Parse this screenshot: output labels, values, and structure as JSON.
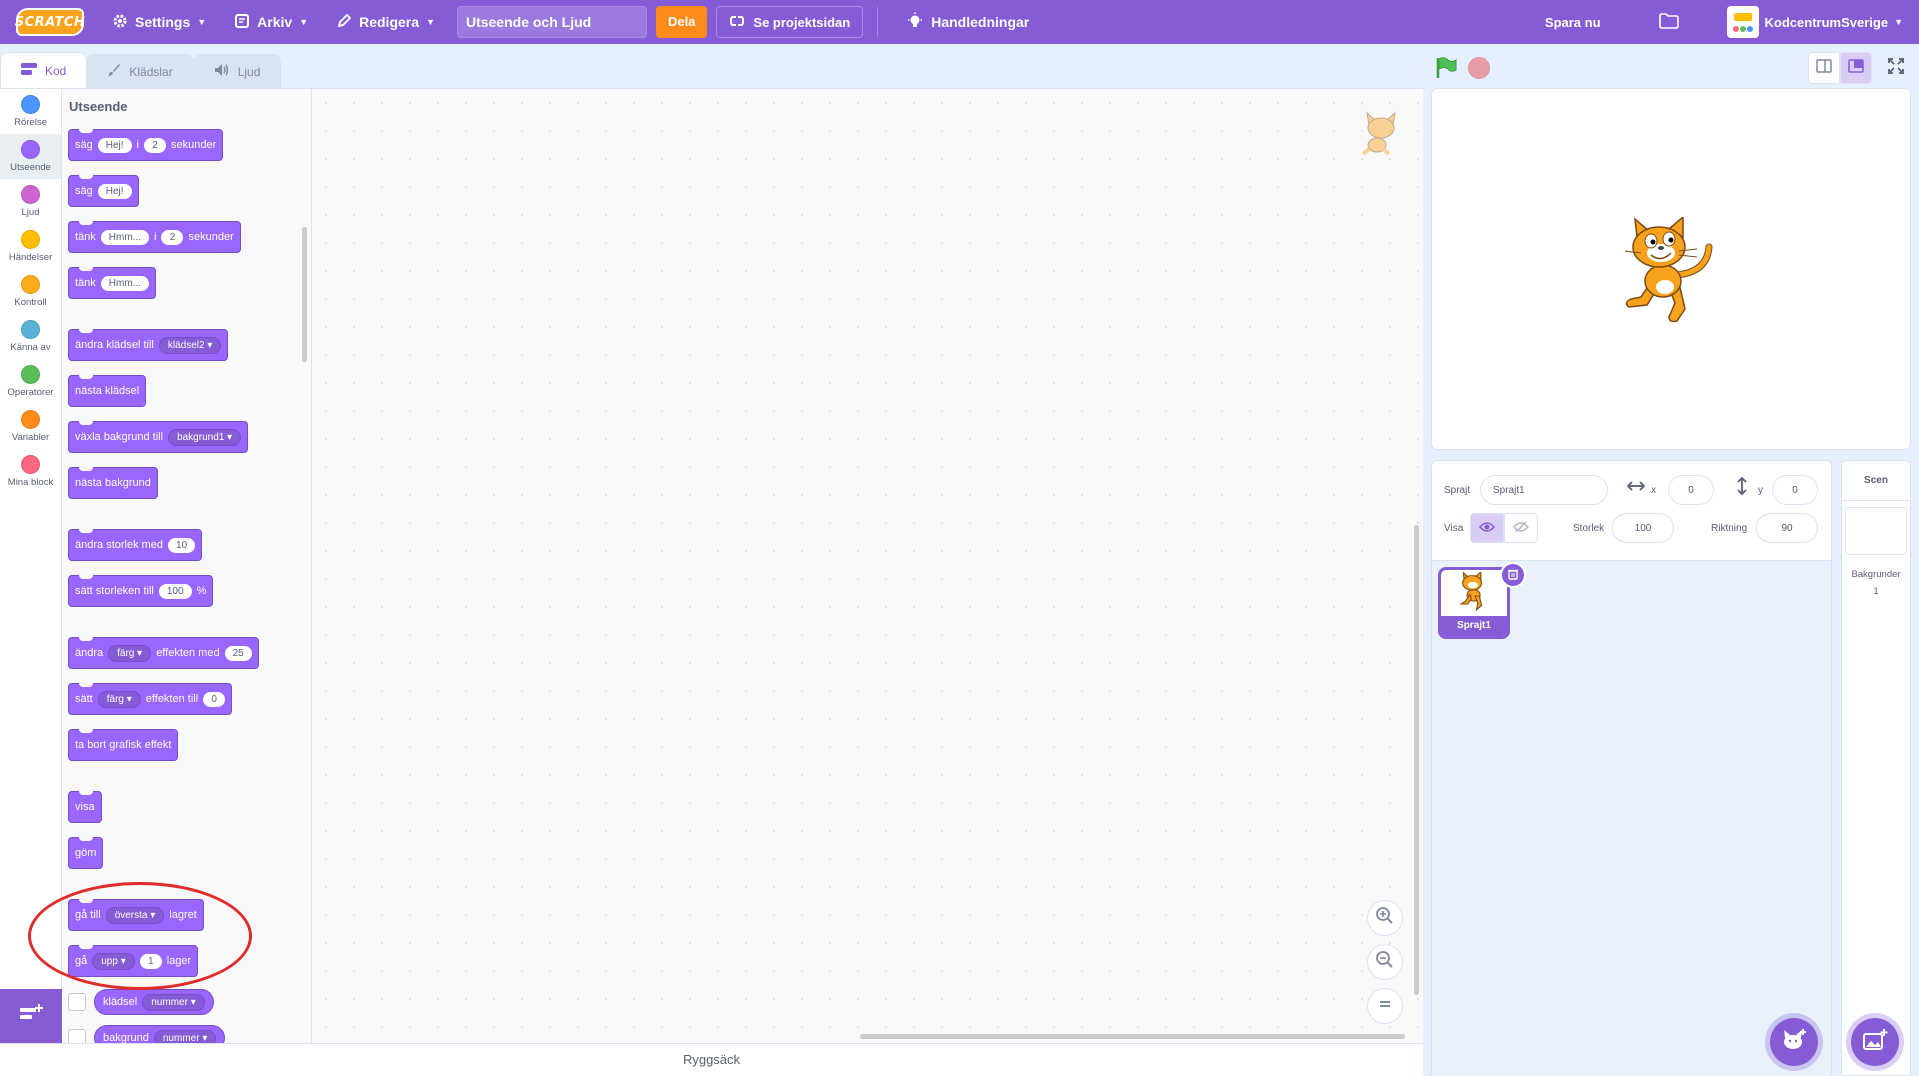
{
  "menubar": {
    "logo_text": "SCRATCH",
    "settings_label": "Settings",
    "file_label": "Arkiv",
    "edit_label": "Redigera",
    "project_title": "Utseende och Ljud",
    "share_label": "Dela",
    "see_project_label": "Se projektsidan",
    "tutorials_label": "Handledningar",
    "save_label": "Spara nu",
    "username": "KodcentrumSverige",
    "accent_color": "#855cd6"
  },
  "tabs": [
    {
      "label": "Kod",
      "icon": "code-icon",
      "active": true
    },
    {
      "label": "Klädslar",
      "icon": "brush-icon",
      "active": false
    },
    {
      "label": "Ljud",
      "icon": "speaker-icon",
      "active": false
    }
  ],
  "categories": [
    {
      "label": "Rörelse",
      "color": "#4c97ff"
    },
    {
      "label": "Utseende",
      "color": "#9966ff"
    },
    {
      "label": "Ljud",
      "color": "#cf63cf"
    },
    {
      "label": "Händelser",
      "color": "#ffbf00"
    },
    {
      "label": "Kontroll",
      "color": "#ffab19"
    },
    {
      "label": "Känna av",
      "color": "#5cb1d6"
    },
    {
      "label": "Operatorer",
      "color": "#59c059"
    },
    {
      "label": "Variabler",
      "color": "#ff8c1a"
    },
    {
      "label": "Mina block",
      "color": "#ff6680"
    }
  ],
  "palette": {
    "title": "Utseende",
    "blocks": {
      "say_for": {
        "t1": "säg",
        "v1": "Hej!",
        "t2": "i",
        "v2": "2",
        "t3": "sekunder"
      },
      "say": {
        "t1": "säg",
        "v1": "Hej!"
      },
      "think_for": {
        "t1": "tänk",
        "v1": "Hmm...",
        "t2": "i",
        "v2": "2",
        "t3": "sekunder"
      },
      "think": {
        "t1": "tänk",
        "v1": "Hmm..."
      },
      "switch_costume": {
        "t1": "ändra klädsel till",
        "d1": "klädsel2"
      },
      "next_costume": {
        "t1": "nästa klädsel"
      },
      "switch_backdrop": {
        "t1": "växla bakgrund till",
        "d1": "bakgrund1"
      },
      "next_backdrop": {
        "t1": "nästa bakgrund"
      },
      "change_size": {
        "t1": "ändra storlek med",
        "v1": "10"
      },
      "set_size": {
        "t1": "sätt storleken till",
        "v1": "100",
        "t2": "%"
      },
      "change_effect": {
        "t1": "ändra",
        "d1": "färg",
        "t2": "effekten med",
        "v1": "25"
      },
      "set_effect": {
        "t1": "sätt",
        "d1": "färg",
        "t2": "effekten till",
        "v1": "0"
      },
      "clear_effects": {
        "t1": "ta bort grafisk effekt"
      },
      "show": {
        "t1": "visa"
      },
      "hide": {
        "t1": "göm"
      },
      "goto_layer": {
        "t1": "gå till",
        "d1": "översta",
        "t2": "lagret"
      },
      "go_layers": {
        "t1": "gå",
        "d1": "upp",
        "v1": "1",
        "t2": "lager"
      },
      "costume_reporter": {
        "t1": "klädsel",
        "d1": "nummer"
      },
      "backdrop_reporter": {
        "t1": "bakgrund",
        "d1": "nummer"
      }
    }
  },
  "workspace": {
    "zoom_in_icon": "zoom-in-icon",
    "zoom_out_icon": "zoom-out-icon",
    "zoom_reset_icon": "zoom-reset-icon"
  },
  "backpack": {
    "label": "Ryggsäck"
  },
  "sprite_info": {
    "sprite_label": "Sprajt",
    "sprite_name": "Sprajt1",
    "x_label": "x",
    "x_value": "0",
    "y_label": "y",
    "y_value": "0",
    "show_label": "Visa",
    "size_label": "Storlek",
    "size_value": "100",
    "direction_label": "Riktning",
    "direction_value": "90"
  },
  "sprites": [
    {
      "name": "Sprajt1",
      "selected": true
    }
  ],
  "stage_pane": {
    "title": "Scen",
    "backdrops_label": "Bakgrunder",
    "backdrops_count": "1"
  }
}
